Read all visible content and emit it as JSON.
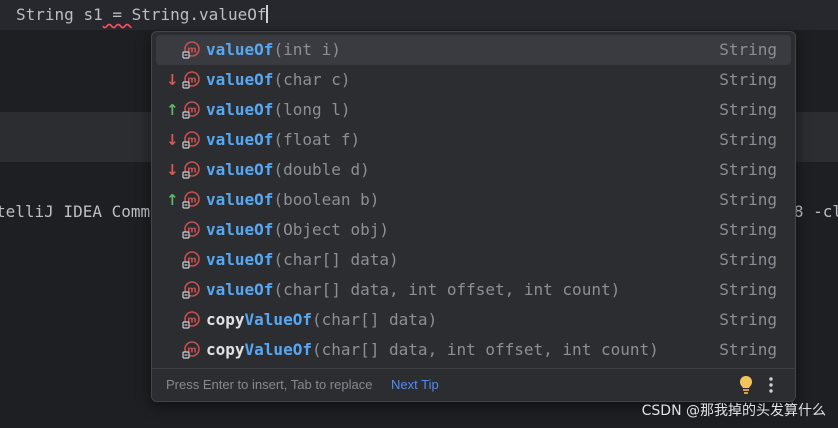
{
  "editor": {
    "code_prefix": "String ",
    "code_var": "s1",
    "code_eq": " = ",
    "code_call": "String.valueOf"
  },
  "console": {
    "line_text": "telliJ IDEA Comm",
    "line_tail": "8 -cl"
  },
  "completion": {
    "items": [
      {
        "prefix": "",
        "name": "valueOf",
        "params": "(int i)",
        "type": "String",
        "arrow": "",
        "selected": true
      },
      {
        "prefix": "",
        "name": "valueOf",
        "params": "(char c)",
        "type": "String",
        "arrow": "down"
      },
      {
        "prefix": "",
        "name": "valueOf",
        "params": "(long l)",
        "type": "String",
        "arrow": "up"
      },
      {
        "prefix": "",
        "name": "valueOf",
        "params": "(float f)",
        "type": "String",
        "arrow": "down"
      },
      {
        "prefix": "",
        "name": "valueOf",
        "params": "(double d)",
        "type": "String",
        "arrow": "down"
      },
      {
        "prefix": "",
        "name": "valueOf",
        "params": "(boolean b)",
        "type": "String",
        "arrow": "up"
      },
      {
        "prefix": "",
        "name": "valueOf",
        "params": "(Object obj)",
        "type": "String",
        "arrow": ""
      },
      {
        "prefix": "",
        "name": "valueOf",
        "params": "(char[] data)",
        "type": "String",
        "arrow": ""
      },
      {
        "prefix": "",
        "name": "valueOf",
        "params": "(char[] data, int offset, int count)",
        "type": "String",
        "arrow": ""
      },
      {
        "prefix": "copy",
        "name": "ValueOf",
        "params": "(char[] data)",
        "type": "String",
        "arrow": ""
      },
      {
        "prefix": "copy",
        "name": "ValueOf",
        "params": "(char[] data, int offset, int count)",
        "type": "String",
        "arrow": ""
      }
    ],
    "footer_hint": "Press Enter to insert, Tab to replace",
    "footer_link": "Next Tip"
  },
  "watermark": "CSDN @那我掉的头发算什么",
  "colors": {
    "accent_match": "#56a8f5",
    "icon_red": "#c94f4f",
    "arrow_down": "#e05555",
    "arrow_up": "#5fb865",
    "bulb": "#f2c55c"
  },
  "icons": {
    "method": "method-m-icon",
    "down": "arrow-down-icon",
    "up": "arrow-up-icon",
    "bulb": "lightbulb-icon",
    "more": "more-vertical-icon"
  }
}
